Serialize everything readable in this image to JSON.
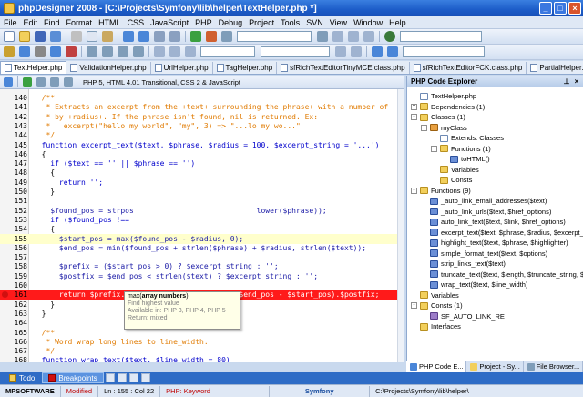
{
  "window": {
    "title": "phpDesigner 2008 - [C:\\Projects\\Symfony\\lib\\helper\\TextHelper.php *]"
  },
  "menu": [
    "File",
    "Edit",
    "Find",
    "Format",
    "HTML",
    "CSS",
    "JavaScript",
    "PHP",
    "Debug",
    "Project",
    "Tools",
    "SVN",
    "View",
    "Window",
    "Help"
  ],
  "file_tabs": [
    {
      "label": "TextHelper.php",
      "active": true
    },
    {
      "label": "ValidationHelper.php",
      "active": false
    },
    {
      "label": "UrlHelper.php",
      "active": false
    },
    {
      "label": "TagHelper.php",
      "active": false
    },
    {
      "label": "sfRichTextEditorTinyMCE.class.php",
      "active": false
    },
    {
      "label": "sfRichTextEditorFCK.class.php",
      "active": false
    },
    {
      "label": "PartialHelper.php",
      "active": false
    }
  ],
  "editor": {
    "doctype": "PHP 5, HTML 4.01 Transitional, CSS 2 & JavaScript",
    "lines": [
      {
        "n": "140",
        "text": "  /**",
        "cls": "cm"
      },
      {
        "n": "141",
        "text": "   * Extracts an excerpt from the +text+ surrounding the phrase+ with a number of",
        "cls": "cm"
      },
      {
        "n": "142",
        "text": "   * by +radius+. If the phrase isn't found, nil is returned. Ex:",
        "cls": "cm"
      },
      {
        "n": "143",
        "text": "   *   excerpt(\"hello my world\", \"my\", 3) => \"...lo my wo...\"",
        "cls": "cm"
      },
      {
        "n": "144",
        "text": "   */",
        "cls": "cm"
      },
      {
        "n": "145",
        "text": "  function excerpt_text($text, $phrase, $radius = 100, $excerpt_string = '...')",
        "cls": "kw"
      },
      {
        "n": "146",
        "text": "  {",
        "cls": ""
      },
      {
        "n": "147",
        "text": "    if ($text == '' || $phrase == '')",
        "cls": "kw"
      },
      {
        "n": "148",
        "text": "    {",
        "cls": ""
      },
      {
        "n": "149",
        "text": "      return '';",
        "cls": "kw"
      },
      {
        "n": "150",
        "text": "    }",
        "cls": ""
      },
      {
        "n": "151",
        "text": "",
        "cls": ""
      },
      {
        "n": "152",
        "text": "    $found_pos = strpos                            lower($phrase));",
        "cls": "vr"
      },
      {
        "n": "153",
        "text": "    if ($found_pos !==",
        "cls": "kw"
      },
      {
        "n": "154",
        "text": "    {",
        "cls": ""
      },
      {
        "n": "155",
        "text": "      $start_pos = max($found_pos - $radius, 0);",
        "cls": "vr",
        "hl": true
      },
      {
        "n": "156",
        "text": "      $end_pos = min($found_pos + strlen($phrase) + $radius, strlen($text));",
        "cls": "vr"
      },
      {
        "n": "157",
        "text": "",
        "cls": ""
      },
      {
        "n": "158",
        "text": "      $prefix = ($start_pos > 0) ? $excerpt_string : '';",
        "cls": "vr"
      },
      {
        "n": "159",
        "text": "      $postfix = $end_pos < strlen($text) ? $excerpt_string : '';",
        "cls": "vr"
      },
      {
        "n": "160",
        "text": "",
        "cls": ""
      },
      {
        "n": "161",
        "text": "      return $prefix.substr($text, $start_pos, $end_pos - $start_pos).$postfix;",
        "cls": "",
        "err": true
      },
      {
        "n": "162",
        "text": "    }",
        "cls": ""
      },
      {
        "n": "163",
        "text": "  }",
        "cls": ""
      },
      {
        "n": "164",
        "text": "",
        "cls": ""
      },
      {
        "n": "165",
        "text": "  /**",
        "cls": "cm"
      },
      {
        "n": "166",
        "text": "   * Word wrap long lines to line_width.",
        "cls": "cm"
      },
      {
        "n": "167",
        "text": "   */",
        "cls": "cm"
      },
      {
        "n": "168",
        "text": "  function wrap_text($text, $line_width = 80)",
        "cls": "kw"
      }
    ]
  },
  "tooltip": {
    "signature_prefix": "max(",
    "signature_arg": "array numbers",
    "signature_suffix": ");",
    "desc": "Find highest value",
    "avail": "Available in: PHP 3, PHP 4, PHP 5",
    "ret": "Return: mixed"
  },
  "explorer": {
    "title": "PHP Code Explorer",
    "pin_icon": "pin-icon",
    "close_glyph": "×",
    "rows": [
      {
        "label": "TextHelper.php",
        "icon": "file",
        "expander": "",
        "depth": 0
      },
      {
        "label": "Dependencies  (1)",
        "icon": "folder",
        "expander": "+",
        "depth": 0
      },
      {
        "label": "Classes  (1)",
        "icon": "folder",
        "expander": "-",
        "depth": 0
      },
      {
        "label": "myClass",
        "icon": "cls",
        "expander": "-",
        "depth": 1
      },
      {
        "label": "Extends: Classes",
        "icon": "file",
        "expander": "",
        "depth": 2
      },
      {
        "label": "Functions  (1)",
        "icon": "folder",
        "expander": "-",
        "depth": 2
      },
      {
        "label": "toHTML()",
        "icon": "func",
        "expander": "",
        "depth": 3
      },
      {
        "label": "Variables",
        "icon": "folder",
        "expander": "",
        "depth": 2
      },
      {
        "label": "Consts",
        "icon": "folder",
        "expander": "",
        "depth": 2
      },
      {
        "label": "Functions  (9)",
        "icon": "folder",
        "expander": "-",
        "depth": 0
      },
      {
        "label": "_auto_link_email_addresses($text)",
        "icon": "func",
        "expander": "",
        "depth": 1
      },
      {
        "label": "_auto_link_urls($text, $href_options)",
        "icon": "func",
        "expander": "",
        "depth": 1
      },
      {
        "label": "auto_link_text($text, $link, $href_options)",
        "icon": "func",
        "expander": "",
        "depth": 1
      },
      {
        "label": "excerpt_text($text, $phrase, $radius, $excerpt_st",
        "icon": "func",
        "expander": "",
        "depth": 1
      },
      {
        "label": "highlight_text($text, $phrase, $highlighter)",
        "icon": "func",
        "expander": "",
        "depth": 1
      },
      {
        "label": "simple_format_text($text, $options)",
        "icon": "func",
        "expander": "",
        "depth": 1
      },
      {
        "label": "strip_links_text($text)",
        "icon": "func",
        "expander": "",
        "depth": 1
      },
      {
        "label": "truncate_text($text, $length, $truncate_string, $t",
        "icon": "func",
        "expander": "",
        "depth": 1
      },
      {
        "label": "wrap_text($text, $line_width)",
        "icon": "func",
        "expander": "",
        "depth": 1
      },
      {
        "label": "Variables",
        "icon": "folder",
        "expander": "",
        "depth": 0
      },
      {
        "label": "Consts  (1)",
        "icon": "folder",
        "expander": "-",
        "depth": 0
      },
      {
        "label": "SF_AUTO_LINK_RE",
        "icon": "cst",
        "expander": "",
        "depth": 1
      },
      {
        "label": "Interfaces",
        "icon": "folder",
        "expander": "",
        "depth": 0
      }
    ]
  },
  "panel_tabs": [
    {
      "label": "PHP Code E...",
      "active": true
    },
    {
      "label": "Project - Sy...",
      "active": false
    },
    {
      "label": "File Browser...",
      "active": false
    }
  ],
  "bottom_tabs": [
    {
      "label": "Todo",
      "active": false
    },
    {
      "label": "Breakpoints",
      "active": true
    }
  ],
  "status": {
    "company": "MPSOFTWARE",
    "modified": "Modified",
    "position": "Ln   : 155 : Col 22",
    "keyword": "PHP: Keyword",
    "framework": "Symfony",
    "path": "C:\\Projects\\Symfony\\lib\\helper\\"
  },
  "colors": {
    "accent": "#1c5cc8",
    "error_line": "#ff1a1a",
    "current_line": "#ffffcc",
    "comment": "#e07a00",
    "keyword": "#0000cc"
  }
}
